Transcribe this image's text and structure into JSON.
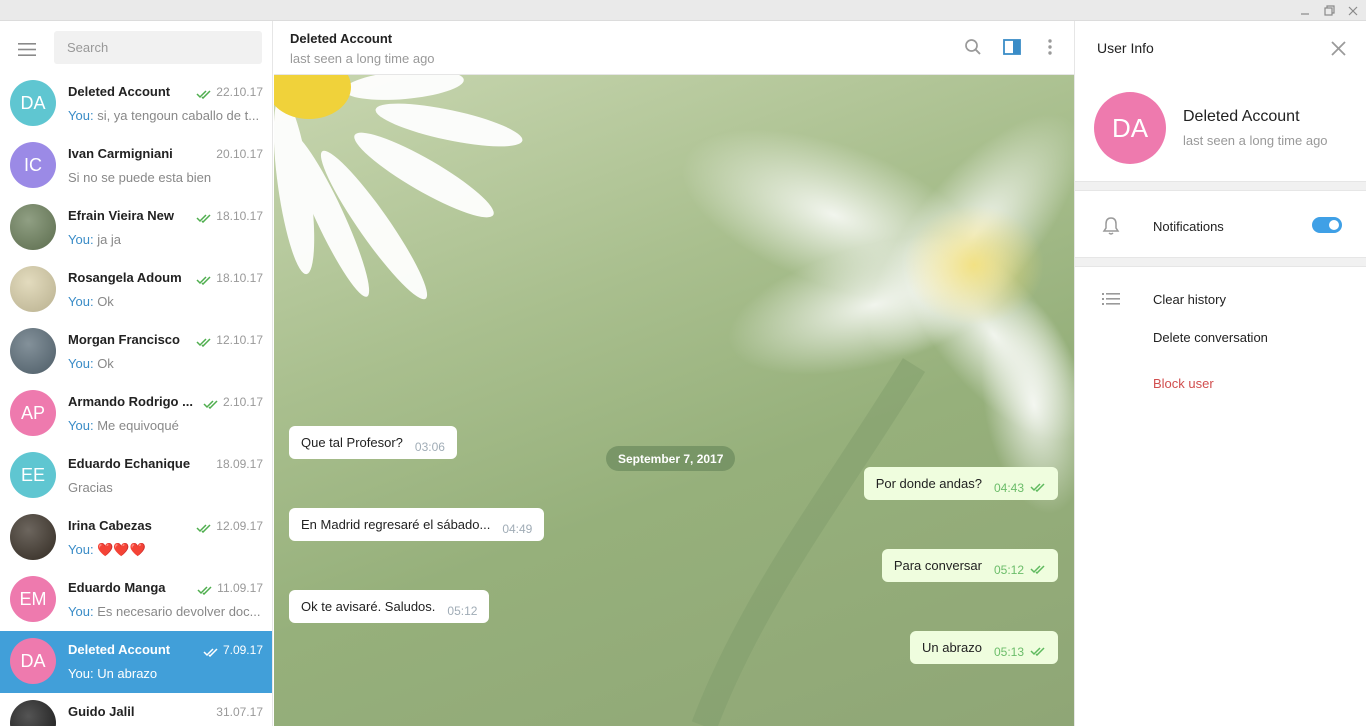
{
  "window": {
    "controls": [
      "minimize",
      "restore",
      "close"
    ]
  },
  "sidebar": {
    "search_placeholder": "Search",
    "chats": [
      {
        "name": "Deleted Account",
        "date": "22.10.17",
        "you": "You:",
        "preview": "si, ya tengoun caballo de t...",
        "initials": "DA",
        "color": "#5fc6d1",
        "read": true
      },
      {
        "name": "Ivan Carmigniani",
        "date": "20.10.17",
        "you": "",
        "preview": "Si no se puede esta bien",
        "initials": "IC",
        "color": "#9b8ae6",
        "read": false
      },
      {
        "name": "Efrain Vieira New",
        "date": "18.10.17",
        "you": "You:",
        "preview": "ja ja",
        "initials": "",
        "color": "#6b7f5a",
        "read": true
      },
      {
        "name": "Rosangela Adoum",
        "date": "18.10.17",
        "you": "You:",
        "preview": "Ok",
        "initials": "",
        "color": "#d9cfa8",
        "read": true
      },
      {
        "name": "Morgan Francisco",
        "date": "12.10.17",
        "you": "You:",
        "preview": "Ok",
        "initials": "",
        "color": "#5a6c78",
        "read": true
      },
      {
        "name": "Armando Rodrigo ...",
        "date": "2.10.17",
        "you": "You:",
        "preview": "Me equivoqué",
        "initials": "AP",
        "color": "#ee7aae",
        "read": true
      },
      {
        "name": "Eduardo Echanique",
        "date": "18.09.17",
        "you": "",
        "preview": "Gracias",
        "initials": "EE",
        "color": "#5fc6d1",
        "read": false
      },
      {
        "name": "Irina Cabezas",
        "date": "12.09.17",
        "you": "You:",
        "preview": "❤️❤️❤️",
        "initials": "",
        "color": "#3b3228",
        "read": true
      },
      {
        "name": "Eduardo Manga",
        "date": "11.09.17",
        "you": "You:",
        "preview": "Es necesario devolver doc...",
        "initials": "EM",
        "color": "#ee7aae",
        "read": true
      },
      {
        "name": "Deleted Account",
        "date": "7.09.17",
        "you": "You:",
        "preview": "Un abrazo",
        "initials": "DA",
        "color": "#ee7aae",
        "read": true,
        "active": true
      },
      {
        "name": "Guido Jalil",
        "date": "31.07.17",
        "you": "",
        "preview": "",
        "initials": "",
        "color": "#1b1b1b",
        "read": false
      }
    ]
  },
  "chat": {
    "name": "Deleted Account",
    "status": "last seen a long time ago",
    "date_divider": "September 7, 2017",
    "messages": [
      {
        "dir": "in",
        "text": "Que tal Profesor?",
        "time": "03:06"
      },
      {
        "dir": "out",
        "text": "Por donde andas?",
        "time": "04:43"
      },
      {
        "dir": "in",
        "text": "En Madrid regresaré el sábado...",
        "time": "04:49"
      },
      {
        "dir": "out",
        "text": "Para conversar",
        "time": "05:12"
      },
      {
        "dir": "in",
        "text": "Ok te avisaré.  Saludos.",
        "time": "05:12"
      },
      {
        "dir": "out",
        "text": "Un abrazo",
        "time": "05:13"
      }
    ]
  },
  "user_info": {
    "title": "User Info",
    "initials": "DA",
    "name": "Deleted Account",
    "status": "last seen a long time ago",
    "notifications_label": "Notifications",
    "notifications_on": true,
    "clear_history": "Clear history",
    "delete_conversation": "Delete conversation",
    "block_user": "Block user"
  },
  "colors": {
    "accent": "#419fd9",
    "danger": "#d14e4e",
    "outgoing_bubble": "#effdde"
  }
}
